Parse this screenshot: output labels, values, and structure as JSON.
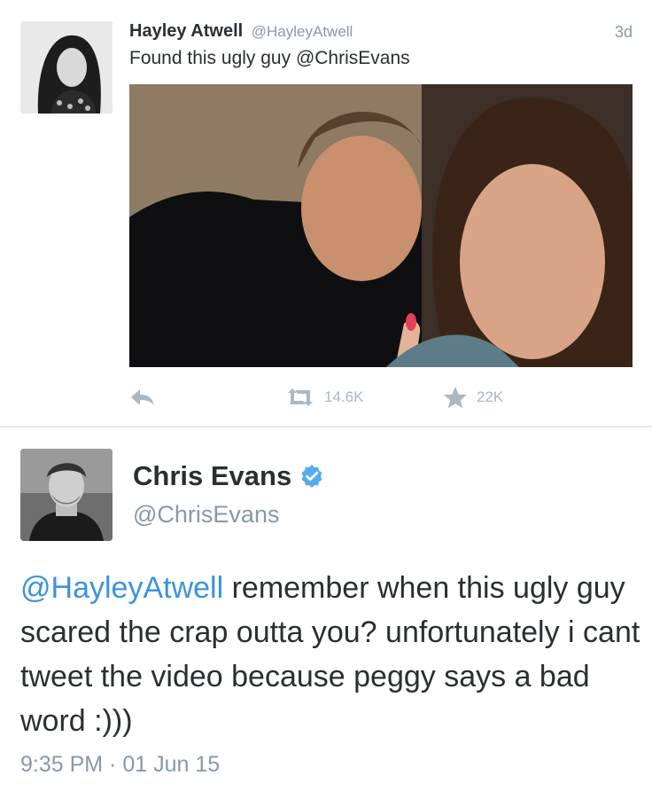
{
  "tweet1": {
    "name": "Hayley Atwell",
    "handle": "@HayleyAtwell",
    "time": "3d",
    "text": "Found this ugly guy @ChrisEvans",
    "actions": {
      "reply_icon": "reply-icon",
      "retweet_icon": "retweet-icon",
      "retweet_count": "14.6K",
      "favorite_icon": "star-icon",
      "favorite_count": "22K"
    }
  },
  "tweet2": {
    "name": "Chris Evans",
    "verified_icon": "verified-badge-icon",
    "handle": "@ChrisEvans",
    "mention": "@HayleyAtwell",
    "text": " remember when this ugly guy scared the crap outta you? unfortunately i cant tweet the video because peggy says a bad word :)))",
    "timestamp": "9:35 PM · 01 Jun 15"
  },
  "colors": {
    "link": "#3b94d9",
    "muted": "#8899a6",
    "icon": "#aab8c2",
    "verified": "#55acee",
    "text": "#292f33"
  }
}
